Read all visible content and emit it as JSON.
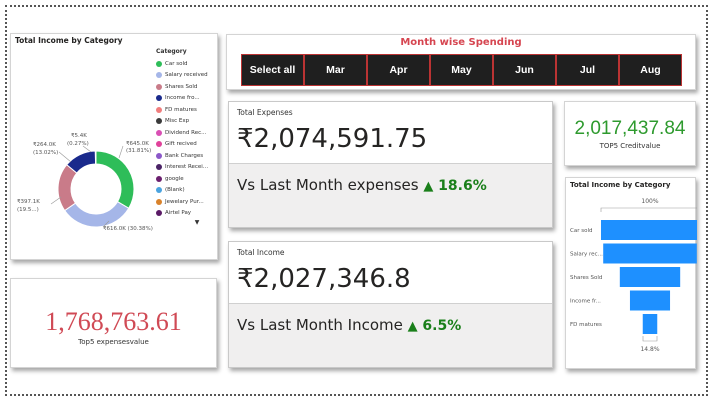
{
  "donut": {
    "title": "Total Income by Category",
    "legend_title": "Category",
    "legend": [
      {
        "label": "Car sold",
        "color": "#2ebd59"
      },
      {
        "label": "Salary received",
        "color": "#a5b6e8"
      },
      {
        "label": "Shares Sold",
        "color": "#c97b89"
      },
      {
        "label": "Income fro...",
        "color": "#1a2a8c"
      },
      {
        "label": "FD matures",
        "color": "#f07d7d"
      },
      {
        "label": "Misc Exp",
        "color": "#3b3b3b"
      },
      {
        "label": "Dividend Rec...",
        "color": "#d94fb4"
      },
      {
        "label": "Gift recived",
        "color": "#e0429a"
      },
      {
        "label": "Bank Charges",
        "color": "#8b58c9"
      },
      {
        "label": "Interest Recei...",
        "color": "#4a2366"
      },
      {
        "label": "google",
        "color": "#6b1f6e"
      },
      {
        "label": "(Blank)",
        "color": "#4aa3df"
      },
      {
        "label": "Jewelary Pur...",
        "color": "#d9822b"
      },
      {
        "label": "Airtel Pay",
        "color": "#5a1a66"
      }
    ],
    "more_icon": "caret-down",
    "labels": {
      "car": [
        "₹645.0K",
        "(31.81%)"
      ],
      "salary": [
        "₹616.0K (30.38%)"
      ],
      "shares": [
        "₹397.1K",
        "(19.5...)"
      ],
      "income": [
        "₹264.0K",
        "(13.02%)"
      ],
      "fd": [
        "₹5.4K",
        "(0.27%)"
      ]
    }
  },
  "chart_data": [
    {
      "type": "pie",
      "title": "Total Income by Category",
      "categories": [
        "Car sold",
        "Salary received",
        "Shares Sold",
        "Income fro...",
        "FD matures"
      ],
      "values": [
        645.0,
        616.0,
        397.1,
        264.0,
        5.4
      ],
      "percentages": [
        31.81,
        30.38,
        19.5,
        13.02,
        0.27
      ],
      "unit": "₹K",
      "legend_position": "right"
    },
    {
      "type": "bar",
      "subtype": "funnel",
      "title": "Total Income by Category",
      "categories": [
        "Car sold",
        "Salary rec...",
        "Shares Sold",
        "Income fr...",
        "FD matures"
      ],
      "values": [
        100,
        95.5,
        61.6,
        40.9,
        14.8
      ],
      "top_label": "100%",
      "bottom_label": "14.8%"
    }
  ],
  "slicer": {
    "title": "Month wise Spending",
    "months": [
      "Select all",
      "Mar",
      "Apr",
      "May",
      "Jun",
      "Jul",
      "Aug"
    ]
  },
  "expenses_kpi": {
    "label": "Total Expenses",
    "value": "₹2,074,591.75",
    "vs_text": "Vs Last Month expenses",
    "arrow": "▲",
    "pct": "18.6%"
  },
  "income_kpi": {
    "label": "Total Income",
    "value": "₹2,027,346.8",
    "vs_text": "Vs Last Month Income",
    "arrow": "▲",
    "pct": "6.5%"
  },
  "credit": {
    "value": "2,017,437.84",
    "caption": "TOP5 Creditvalue"
  },
  "expenses_value": {
    "value": "1,768,763.61",
    "caption": "Top5 expensesvalue"
  },
  "funnel": {
    "title": "Total Income by Category"
  },
  "colors": {
    "accent_green": "#2e9a2e",
    "accent_red": "#d04a55",
    "funnel_blue": "#1e90ff"
  }
}
